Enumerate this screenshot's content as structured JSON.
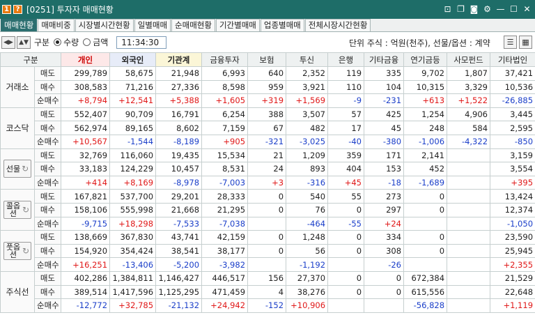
{
  "titlebar": {
    "number": "1",
    "help": "?",
    "title": "[0251] 투자자 매매현황",
    "icons": [
      "pin-icon",
      "copy-icon",
      "camera-icon",
      "gear-icon",
      "minimize-icon",
      "maximize-icon",
      "close-icon"
    ]
  },
  "tabs": [
    "매매현황",
    "매매비중",
    "시장별시간현황",
    "일별매매",
    "순매매현황",
    "기간별매매",
    "업종별매매",
    "전체시장시간현황"
  ],
  "toolbar": {
    "gubun_label": "구분",
    "radio_qty": "수량",
    "radio_amt": "금액",
    "time": "11:34:30",
    "unit_text": "단위 주식 : 억원(천주), 선물/옵션 : 계약"
  },
  "table": {
    "headers": [
      "구분",
      "",
      "개인",
      "외국인",
      "기관계",
      "금융투자",
      "보험",
      "투신",
      "은행",
      "기타금융",
      "연기금등",
      "사모펀드",
      "기타법인"
    ],
    "row_labels": [
      "매도",
      "매수",
      "순매수"
    ],
    "groups": [
      {
        "label": "거래소",
        "rows": [
          [
            "299,789",
            "58,675",
            "21,948",
            "6,993",
            "640",
            "2,352",
            "119",
            "335",
            "9,702",
            "1,807",
            "37,421"
          ],
          [
            "308,583",
            "71,216",
            "27,336",
            "8,598",
            "959",
            "3,921",
            "110",
            "104",
            "10,315",
            "3,329",
            "10,536"
          ],
          [
            "+8,794",
            "+12,541",
            "+5,388",
            "+1,605",
            "+319",
            "+1,569",
            "-9",
            "-231",
            "+613",
            "+1,522",
            "-26,885"
          ]
        ]
      },
      {
        "label": "코스닥",
        "rows": [
          [
            "552,407",
            "90,709",
            "16,791",
            "6,254",
            "388",
            "3,507",
            "57",
            "425",
            "1,254",
            "4,906",
            "3,445"
          ],
          [
            "562,974",
            "89,165",
            "8,602",
            "7,159",
            "67",
            "482",
            "17",
            "45",
            "248",
            "584",
            "2,595"
          ],
          [
            "+10,567",
            "-1,544",
            "-8,189",
            "+905",
            "-321",
            "-3,025",
            "-40",
            "-380",
            "-1,006",
            "-4,322",
            "-850"
          ]
        ]
      },
      {
        "label": "선물",
        "rows": [
          [
            "32,769",
            "116,060",
            "19,435",
            "15,534",
            "21",
            "1,209",
            "359",
            "171",
            "2,141",
            "",
            "3,159"
          ],
          [
            "33,183",
            "124,229",
            "10,457",
            "8,531",
            "24",
            "893",
            "404",
            "153",
            "452",
            "",
            "3,554"
          ],
          [
            "+414",
            "+8,169",
            "-8,978",
            "-7,003",
            "+3",
            "-316",
            "+45",
            "-18",
            "-1,689",
            "",
            "+395"
          ]
        ]
      },
      {
        "label": "콜옵션",
        "rows": [
          [
            "167,821",
            "537,700",
            "29,201",
            "28,333",
            "0",
            "540",
            "55",
            "273",
            "0",
            "",
            "13,424"
          ],
          [
            "158,106",
            "555,998",
            "21,668",
            "21,295",
            "0",
            "76",
            "0",
            "297",
            "0",
            "",
            "12,374"
          ],
          [
            "-9,715",
            "+18,298",
            "-7,533",
            "-7,038",
            "",
            "-464",
            "-55",
            "+24",
            "",
            "",
            "-1,050"
          ]
        ]
      },
      {
        "label": "풋옵션",
        "rows": [
          [
            "138,669",
            "367,830",
            "43,741",
            "42,159",
            "0",
            "1,248",
            "0",
            "334",
            "0",
            "",
            "23,590"
          ],
          [
            "154,920",
            "354,424",
            "38,541",
            "38,177",
            "0",
            "56",
            "0",
            "308",
            "0",
            "",
            "25,945"
          ],
          [
            "+16,251",
            "-13,406",
            "-5,200",
            "-3,982",
            "",
            "-1,192",
            "",
            "-26",
            "",
            "",
            "+2,355"
          ]
        ]
      },
      {
        "label": "주식선",
        "rows": [
          [
            "402,286",
            "1,384,811",
            "1,146,427",
            "446,517",
            "156",
            "27,370",
            "0",
            "0",
            "672,384",
            "",
            "21,529"
          ],
          [
            "389,514",
            "1,417,596",
            "1,125,295",
            "471,459",
            "4",
            "38,276",
            "0",
            "0",
            "615,556",
            "",
            "22,648"
          ],
          [
            "-12,772",
            "+32,785",
            "-21,132",
            "+24,942",
            "-152",
            "+10,906",
            "",
            "",
            "-56,828",
            "",
            "+1,119"
          ]
        ]
      }
    ]
  },
  "colors": {
    "titlebar": "#1e6d68",
    "positive": "#e01818",
    "negative": "#1a3ec9",
    "active_tab": "#2c6f70"
  }
}
